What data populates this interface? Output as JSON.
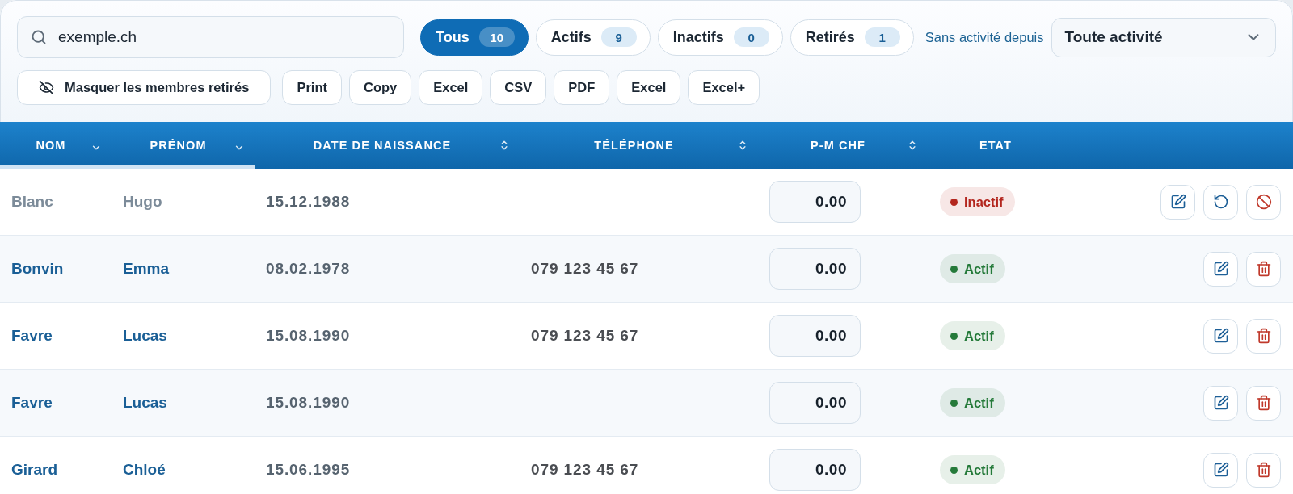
{
  "search": {
    "value": "exemple.ch"
  },
  "filters": [
    {
      "label": "Tous",
      "count": "10",
      "selected": true
    },
    {
      "label": "Actifs",
      "count": "9",
      "selected": false
    },
    {
      "label": "Inactifs",
      "count": "0",
      "selected": false
    },
    {
      "label": "Retirés",
      "count": "1",
      "selected": false
    }
  ],
  "inactivity_filter": {
    "label": "Sans activité depuis",
    "value": "Toute activité"
  },
  "hide_retired_button": {
    "label": "Masquer les membres retirés"
  },
  "export_buttons": [
    "Print",
    "Copy",
    "Excel",
    "CSV",
    "PDF",
    "Excel",
    "Excel+"
  ],
  "table": {
    "columns": [
      {
        "label": "NOM",
        "sortable": true,
        "sorted": true
      },
      {
        "label": "PRÉNOM",
        "sortable": true,
        "sorted": true
      },
      {
        "label": "DATE DE NAISSANCE",
        "sortable": true,
        "sorted": false
      },
      {
        "label": "TÉLÉPHONE",
        "sortable": true,
        "sorted": false
      },
      {
        "label": "P-M CHF",
        "sortable": true,
        "sorted": false
      },
      {
        "label": "ETAT",
        "sortable": false,
        "sorted": false
      }
    ],
    "rows": [
      {
        "last_name": "Blanc",
        "first_name": "Hugo",
        "greyed": true,
        "birth_date": "15.12.1988",
        "pm_chf": "0.00",
        "status": {
          "label": "Inactif",
          "color": "#b3261e"
        },
        "actions": [
          {
            "kind": "edit"
          },
          {
            "kind": "restore"
          },
          {
            "kind": "block"
          }
        ]
      },
      {
        "last_name": "Bonvin",
        "first_name": "Emma",
        "greyed": false,
        "birth_date": "08.02.1978",
        "phone": "079 123 45 67",
        "pm_chf": "0.00",
        "status": {
          "label": "Actif",
          "color": "#257a3a"
        },
        "actions": [
          {
            "kind": "edit"
          },
          {
            "kind": "delete"
          }
        ]
      },
      {
        "last_name": "Favre",
        "first_name": "Lucas",
        "greyed": false,
        "birth_date": "15.08.1990",
        "phone": "079 123 45 67",
        "pm_chf": "0.00",
        "status": {
          "label": "Actif",
          "color": "#257a3a"
        },
        "actions": [
          {
            "kind": "edit"
          },
          {
            "kind": "delete"
          }
        ]
      },
      {
        "last_name": "Favre",
        "first_name": "Lucas",
        "greyed": false,
        "birth_date": "15.08.1990",
        "pm_chf": "0.00",
        "status": {
          "label": "Actif",
          "color": "#257a3a"
        },
        "actions": [
          {
            "kind": "edit"
          },
          {
            "kind": "delete"
          }
        ]
      },
      {
        "last_name": "Girard",
        "first_name": "Chloé",
        "greyed": false,
        "birth_date": "15.06.1995",
        "phone": "079 123 45 67",
        "pm_chf": "0.00",
        "status": {
          "label": "Actif",
          "color": "#257a3a"
        },
        "actions": [
          {
            "kind": "edit"
          },
          {
            "kind": "delete"
          }
        ]
      }
    ]
  }
}
